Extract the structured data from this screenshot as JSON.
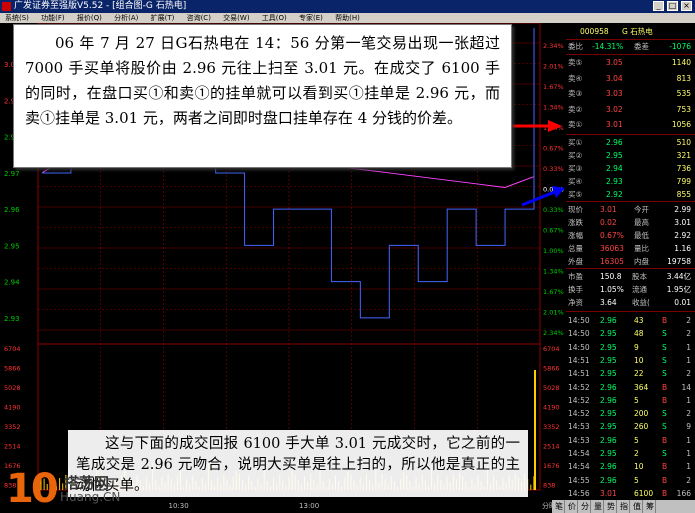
{
  "window": {
    "title": "广发证券至强版V5.52 - [组合图-G 石热电]",
    "buttons": [
      "_",
      "□",
      "×"
    ]
  },
  "menu": {
    "items": [
      "系统(S)",
      "功能(F)",
      "报价(Q)",
      "分析(A)",
      "扩展(T)",
      "咨询(C)",
      "交易(W)",
      "工具(O)",
      "专家(E)",
      "帮助(H)"
    ]
  },
  "chart": {
    "prices": [
      "2.99",
      "2.98",
      "2.97",
      "2.96",
      "2.95",
      "2.94",
      "2.93"
    ],
    "price_top": "3.00",
    "pcts_right": [
      "2.34%",
      "2.01%",
      "1.67%",
      "1.34%",
      "1.00%",
      "0.67%",
      "0.33%",
      "0.00%",
      "0.33%",
      "0.67%",
      "1.00%",
      "1.34%",
      "1.67%",
      "2.01%",
      "2.34%"
    ],
    "vol_labels": [
      "6704",
      "5866",
      "5028",
      "4190",
      "3352",
      "2514",
      "1676",
      "838"
    ],
    "time_labels": [
      "10:30",
      "13:00"
    ],
    "corner_label": "分时",
    "colors": {
      "price_line": "#ffffff",
      "avg_line": "#ff44ff",
      "grid": "#8b0000",
      "volume": "#ffcc00",
      "axis_up": "#ff3333",
      "axis_down": "#00cc00"
    }
  },
  "chart_data": {
    "type": "line",
    "title": "G 石热电",
    "x": [
      "09:30",
      "09:45",
      "10:00",
      "10:15",
      "10:30",
      "10:45",
      "11:00",
      "11:15",
      "11:30",
      "13:15",
      "13:30",
      "13:45",
      "14:00",
      "14:15",
      "14:30",
      "14:45",
      "14:56",
      "15:00"
    ],
    "series": [
      {
        "name": "price",
        "values": [
          2.97,
          2.98,
          2.99,
          2.98,
          2.98,
          2.99,
          2.97,
          2.95,
          2.96,
          2.96,
          2.94,
          2.93,
          2.95,
          2.94,
          2.96,
          2.95,
          2.96,
          3.01
        ]
      },
      {
        "name": "avg",
        "values": [
          2.97,
          2.975,
          2.98,
          2.983,
          2.984,
          2.984,
          2.982,
          2.979,
          2.976,
          2.974,
          2.972,
          2.971,
          2.97,
          2.969,
          2.968,
          2.967,
          2.966,
          2.969
        ]
      }
    ],
    "ylim": [
      2.925,
      3.01
    ]
  },
  "quote": {
    "code": "000958",
    "name": "G 石热电",
    "webi_label": "委比",
    "webi": "-14.31%",
    "weicha_label": "委差",
    "weicha": "-1076",
    "sell": [
      {
        "label": "卖⑤",
        "price": "3.05",
        "vol": "1140"
      },
      {
        "label": "卖④",
        "price": "3.04",
        "vol": "813"
      },
      {
        "label": "卖③",
        "price": "3.03",
        "vol": "535"
      },
      {
        "label": "卖②",
        "price": "3.02",
        "vol": "753"
      },
      {
        "label": "卖①",
        "price": "3.01",
        "vol": "1056"
      }
    ],
    "buy": [
      {
        "label": "买①",
        "price": "2.96",
        "vol": "510"
      },
      {
        "label": "买②",
        "price": "2.95",
        "vol": "321"
      },
      {
        "label": "买③",
        "price": "2.94",
        "vol": "736"
      },
      {
        "label": "买④",
        "price": "2.93",
        "vol": "799"
      },
      {
        "label": "买⑤",
        "price": "2.92",
        "vol": "855"
      }
    ],
    "stats": [
      {
        "l1": "现价",
        "v1": "3.01",
        "l2": "今开",
        "v2": "2.99"
      },
      {
        "l1": "涨跌",
        "v1": "0.02",
        "l2": "最高",
        "v2": "3.01"
      },
      {
        "l1": "涨幅",
        "v1": "0.67%",
        "l2": "最低",
        "v2": "2.92"
      },
      {
        "l1": "总量",
        "v1": "36063",
        "l2": "量比",
        "v2": "1.16"
      },
      {
        "l1": "外盘",
        "v1": "16305",
        "l2": "内盘",
        "v2": "19758"
      }
    ],
    "stats2": [
      {
        "l1": "市盈",
        "v1": "150.8",
        "l2": "股本",
        "v2": "3.44亿"
      },
      {
        "l1": "换手",
        "v1": "1.05%",
        "l2": "流通",
        "v2": "1.95亿"
      },
      {
        "l1": "净资",
        "v1": "3.64",
        "l2": "收益(",
        "v2": "0.01"
      }
    ],
    "ticks": [
      {
        "time": "14:50",
        "price": "2.96",
        "vol": "43",
        "bs": "B",
        "n": "2"
      },
      {
        "time": "14:50",
        "price": "2.95",
        "vol": "48",
        "bs": "S",
        "n": "2"
      },
      {
        "time": "14:50",
        "price": "2.95",
        "vol": "9",
        "bs": "S",
        "n": "1"
      },
      {
        "time": "14:51",
        "price": "2.95",
        "vol": "10",
        "bs": "S",
        "n": "1"
      },
      {
        "time": "14:51",
        "price": "2.95",
        "vol": "22",
        "bs": "S",
        "n": "2"
      },
      {
        "time": "14:52",
        "price": "2.96",
        "vol": "364",
        "bs": "B",
        "n": "14"
      },
      {
        "time": "14:52",
        "price": "2.96",
        "vol": "5",
        "bs": "B",
        "n": "1"
      },
      {
        "time": "14:52",
        "price": "2.95",
        "vol": "200",
        "bs": "S",
        "n": "2"
      },
      {
        "time": "14:53",
        "price": "2.95",
        "vol": "260",
        "bs": "S",
        "n": "9"
      },
      {
        "time": "14:53",
        "price": "2.96",
        "vol": "5",
        "bs": "B",
        "n": "1"
      },
      {
        "time": "14:54",
        "price": "2.95",
        "vol": "2",
        "bs": "S",
        "n": "1"
      },
      {
        "time": "14:54",
        "price": "2.96",
        "vol": "10",
        "bs": "B",
        "n": "1"
      },
      {
        "time": "14:55",
        "price": "2.96",
        "vol": "5",
        "bs": "B",
        "n": "2"
      },
      {
        "time": "14:56",
        "price": "3.01",
        "vol": "6100",
        "bs": "B",
        "n": "166"
      }
    ],
    "tabs": [
      "笔",
      "价",
      "分",
      "量",
      "势",
      "指",
      "值",
      "筹"
    ]
  },
  "annotations": {
    "note1": "06 年 7 月 27 日G石热电在 14：56 分第一笔交易出现一张超过 7000 手买单将股价由 2.96 元往上扫至 3.01 元。在成交了 6100 手的同时，在盘口买①和卖①的挂单就可以看到买①挂单是 2.96 元，而卖①挂单是 3.01 元，两者之间即时盘口挂单存在 4 分钱的价差。",
    "note2": "这与下面的成交回报 6100 手大单 3.01 元成交时，它之前的一笔成交是 2.96 元吻合，说明大买单是往上扫的，所以他是真正的主动性买单。"
  },
  "watermark": {
    "number": "10",
    "brand": "搭荡网",
    "url": "Huang.CN"
  }
}
